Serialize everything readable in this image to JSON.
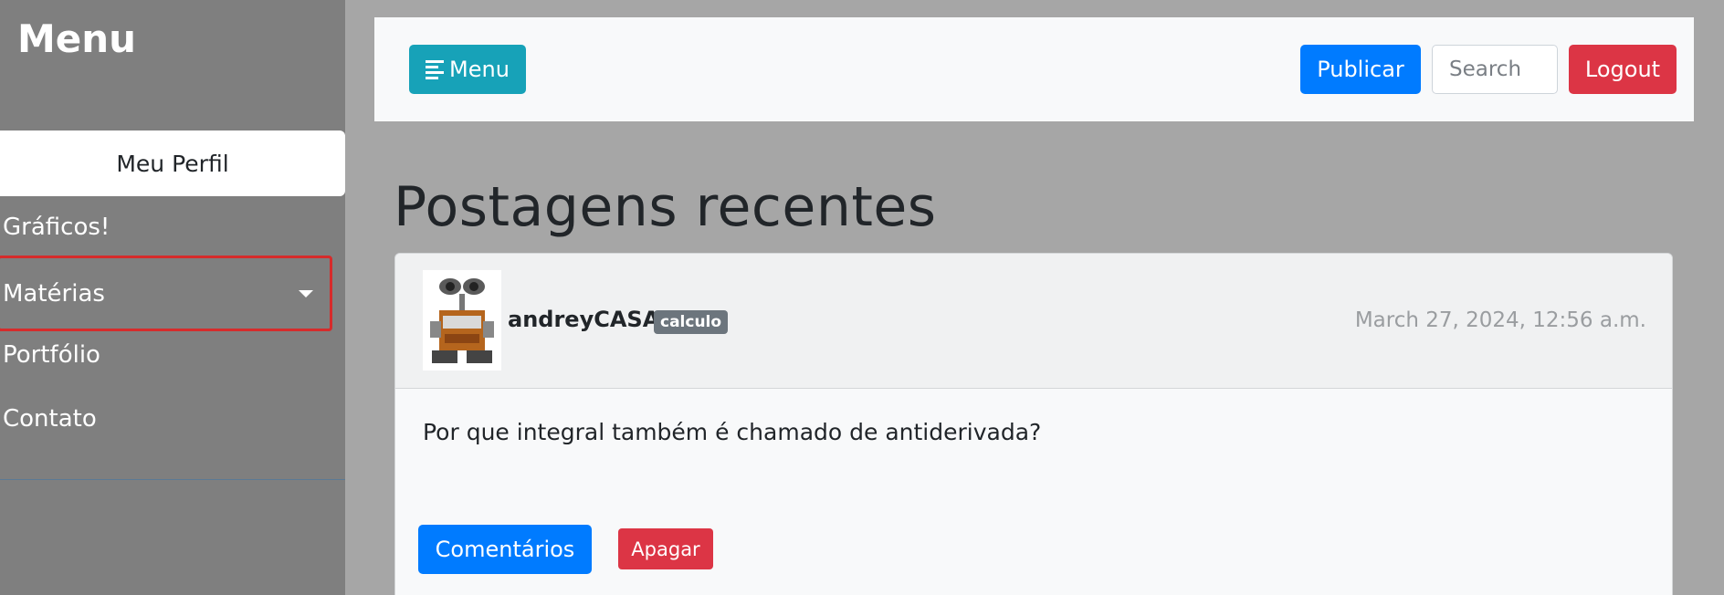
{
  "sidebar": {
    "title": "Menu",
    "profile_label": "Meu Perfil",
    "items": [
      {
        "label": "Gráficos!"
      },
      {
        "label": "Matérias"
      },
      {
        "label": "Portfólio"
      },
      {
        "label": "Contato"
      }
    ]
  },
  "topbar": {
    "menu_label": "Menu",
    "menu_icon": "align-left-icon",
    "publish_label": "Publicar",
    "search_placeholder": "Search",
    "logout_label": "Logout"
  },
  "main": {
    "title": "Postagens recentes",
    "post": {
      "username": "andreyCASA",
      "tag": "calculo",
      "timestamp": "March 27, 2024, 12:56 a.m.",
      "body": "Por que integral também é chamado de antiderivada?",
      "comments_label": "Comentários",
      "delete_label": "Apagar",
      "avatar_icon": "robot-avatar-icon"
    }
  },
  "colors": {
    "primary": "#007bff",
    "danger": "#dc3545",
    "info": "#17a2b8",
    "sidebar_bg": "#7f7f7f",
    "page_bg": "#a6a6a6",
    "highlight_border": "#d62b2b"
  }
}
